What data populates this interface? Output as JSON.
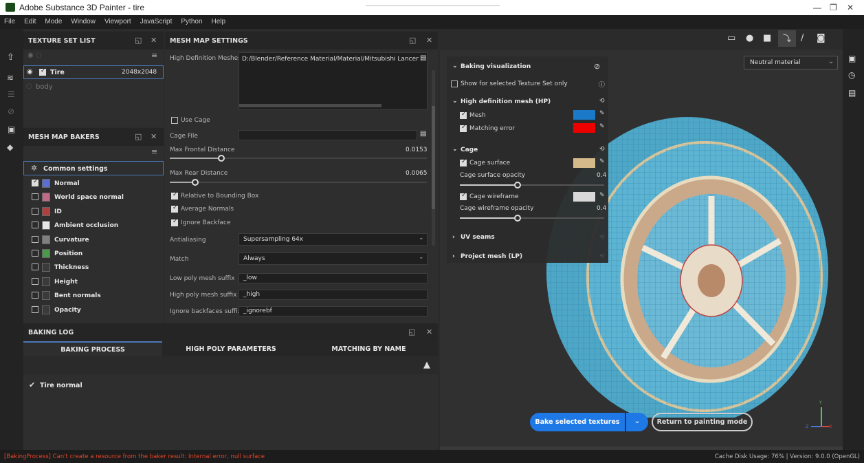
{
  "window": {
    "title": "Adobe Substance 3D Painter - tire",
    "minimize": "—",
    "restore": "❐",
    "close": "✕"
  },
  "menu": [
    "File",
    "Edit",
    "Mode",
    "Window",
    "Viewport",
    "JavaScript",
    "Python",
    "Help"
  ],
  "texture_set_list": {
    "title": "TEXTURE SET LIST",
    "sets": [
      {
        "name": "Tire",
        "resolution": "2048x2048",
        "checked": true,
        "selected": true
      },
      {
        "name": "body",
        "checked": false,
        "selected": false
      }
    ]
  },
  "mesh_map_bakers": {
    "title": "MESH MAP BAKERS",
    "common_settings": "Common settings",
    "bakers": [
      {
        "label": "Normal",
        "checked": true,
        "color": "#5a6fd0"
      },
      {
        "label": "World space normal",
        "checked": false,
        "color": "#c06a8a"
      },
      {
        "label": "ID",
        "checked": false,
        "color": "#b04040"
      },
      {
        "label": "Ambient occlusion",
        "checked": false,
        "color": "#e8e8e8"
      },
      {
        "label": "Curvature",
        "checked": false,
        "color": "#808080"
      },
      {
        "label": "Position",
        "checked": false,
        "color": "#4a9a4a"
      },
      {
        "label": "Thickness",
        "checked": false,
        "color": "#3a3a3a"
      },
      {
        "label": "Height",
        "checked": false,
        "color": "#3a3a3a"
      },
      {
        "label": "Bent normals",
        "checked": false,
        "color": "#3a3a3a"
      },
      {
        "label": "Opacity",
        "checked": false,
        "color": "#3a3a3a"
      }
    ]
  },
  "mesh_map_settings": {
    "title": "MESH MAP SETTINGS",
    "high_def_label": "High Definition Meshes",
    "high_def_value": "D:/Blender/Reference Material/Material/Mitsubishi Lancer evo x/F",
    "use_cage": "Use Cage",
    "cage_file": "Cage File",
    "max_frontal_label": "Max Frontal Distance",
    "max_frontal_value": "0.0153",
    "max_frontal_level": 0.2,
    "max_rear_label": "Max Rear Distance",
    "max_rear_value": "0.0065",
    "max_rear_level": 0.1,
    "relative_bbox": "Relative to Bounding Box",
    "average_normals": "Average Normals",
    "ignore_backface": "Ignore Backface",
    "antialiasing_label": "Antialiasing",
    "antialiasing_value": "Supersampling 64x",
    "match_label": "Match",
    "match_value": "Always",
    "low_suffix_label": "Low poly mesh suffix",
    "low_suffix_value": "_low",
    "high_suffix_label": "High poly mesh suffix",
    "high_suffix_value": "_high",
    "ignore_suffix_label": "Ignore backfaces suffix",
    "ignore_suffix_value": "_ignorebf"
  },
  "baking_log": {
    "title": "BAKING LOG",
    "tabs": [
      "BAKING PROCESS",
      "HIGH POLY PARAMETERS",
      "MATCHING BY NAME"
    ],
    "entry": "Tire normal"
  },
  "viewport": {
    "material": "Neutral material",
    "baking_visualization": "Baking visualization",
    "show_selected": "Show for selected Texture Set only",
    "hp_header": "High definition mesh (HP)",
    "mesh": "Mesh",
    "mesh_color": "#1a7ac8",
    "matching_error": "Matching error",
    "matching_error_color": "#ee0000",
    "cage_header": "Cage",
    "cage_surface": "Cage surface",
    "cage_surface_color": "#d4b98a",
    "cage_surface_opacity_label": "Cage surface opacity",
    "cage_surface_opacity": "0.4",
    "cage_wireframe": "Cage wireframe",
    "cage_wireframe_color": "#d8d8d8",
    "cage_wireframe_opacity_label": "Cage wireframe opacity",
    "cage_wireframe_opacity": "0.4",
    "uv_seams": "UV seams",
    "project_mesh": "Project mesh (LP)",
    "bake_button": "Bake selected textures",
    "return_button": "Return to painting mode",
    "axis_y": "Y",
    "axis_z": "Z",
    "axis_x": "X"
  },
  "status": {
    "error": "[BakingProcess] Can't create a resource from the baker result: Internal error, null surface",
    "cache": "Cache Disk Usage:  76% | Version: 9.0.0 (OpenGL)"
  }
}
